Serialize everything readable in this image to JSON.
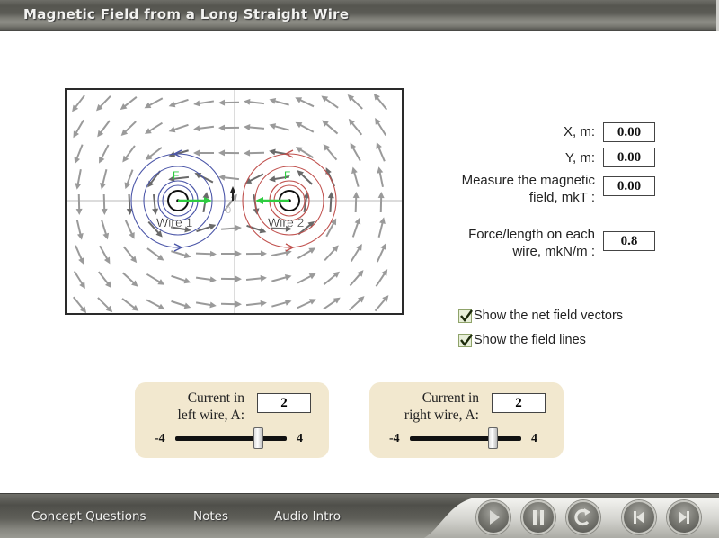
{
  "window": {
    "title": "Magnetic Field from a Long Straight Wire"
  },
  "field_view": {
    "wires": [
      {
        "label": "Wire 1",
        "field_line_color": "#4a55a8"
      },
      {
        "label": "Wire 2",
        "field_line_color": "#c0504d"
      }
    ],
    "force_label": "F",
    "force_color": "#2ecc40",
    "vector_color": "#9a9a9a",
    "probe_label": "0"
  },
  "readouts": {
    "x": {
      "label": "X, m:",
      "value": "0.00"
    },
    "y": {
      "label": "Y, m:",
      "value": "0.00"
    },
    "field": {
      "label_line1": "Measure the magnetic",
      "label_line2": "field, mkT :",
      "value": "0.00"
    },
    "force": {
      "label_line1": "Force/length on each",
      "label_line2": "wire, mkN/m :",
      "value": "0.8"
    }
  },
  "options": [
    {
      "label": "Show the net field vectors",
      "checked": true
    },
    {
      "label": "Show the field lines",
      "checked": true
    }
  ],
  "current_controls": [
    {
      "label_line1": "Current in",
      "label_line2": "left wire, A:",
      "value": "2",
      "min_label": "-4",
      "max_label": "4",
      "min": -4,
      "max": 4,
      "current": 2
    },
    {
      "label_line1": "Current in",
      "label_line2": "right wire, A:",
      "value": "2",
      "min_label": "-4",
      "max_label": "4",
      "min": -4,
      "max": 4,
      "current": 2
    }
  ],
  "bottom_nav": {
    "links": [
      "Concept Questions",
      "Notes",
      "Audio Intro"
    ],
    "controls": [
      "play-icon",
      "pause-icon",
      "replay-icon",
      "skip-back-icon",
      "skip-forward-icon"
    ]
  }
}
